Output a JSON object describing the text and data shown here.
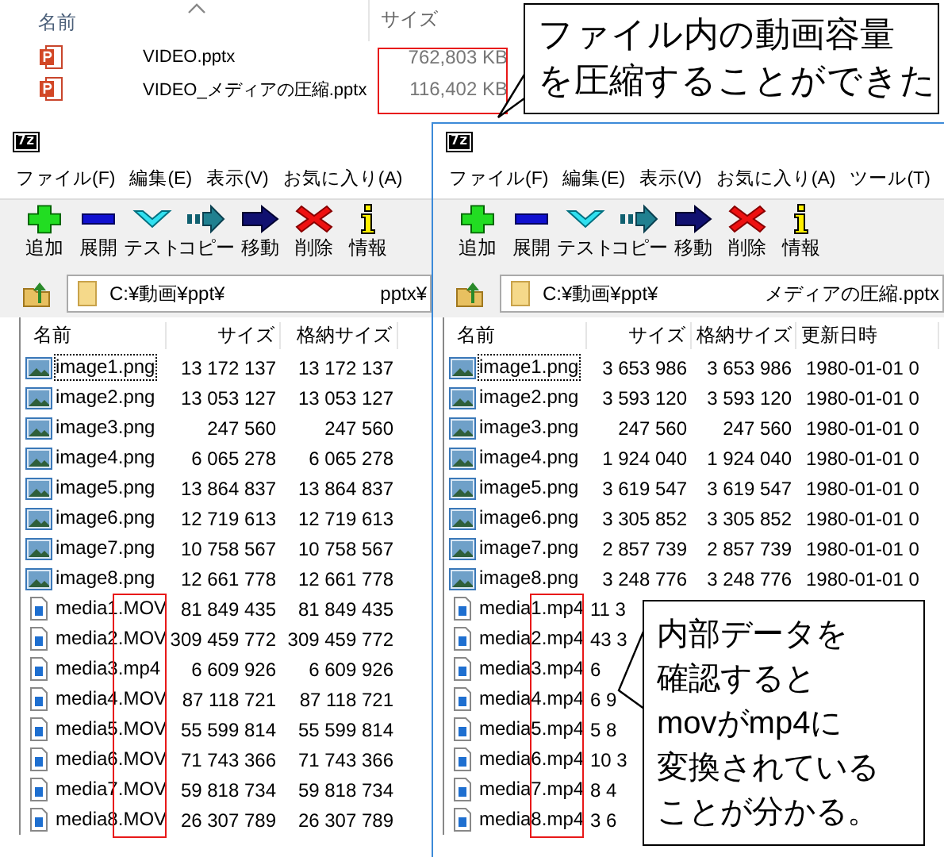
{
  "explorer": {
    "columns": [
      "名前",
      "サイズ"
    ],
    "files": [
      {
        "name": "VIDEO.pptx",
        "size": "762,803 KB"
      },
      {
        "name": "VIDEO_メディアの圧縮.pptx",
        "size": "116,402 KB"
      }
    ]
  },
  "callouts": [
    {
      "lines": [
        "ファイル内の動画容量",
        "を圧縮することができた"
      ]
    },
    {
      "lines": [
        "内部データを",
        "確認すると",
        "movがmp4に",
        "変換されている",
        "ことが分かる。"
      ]
    }
  ],
  "windows": [
    {
      "logo": "7z",
      "menu": [
        "ファイル(F)",
        "編集(E)",
        "表示(V)",
        "お気に入り(A)"
      ],
      "toolbar": [
        {
          "kind": "add",
          "label": "追加"
        },
        {
          "kind": "extract",
          "label": "展開"
        },
        {
          "kind": "test",
          "label": "テスト"
        },
        {
          "kind": "copy",
          "label": "コピー"
        },
        {
          "kind": "move",
          "label": "移動"
        },
        {
          "kind": "delete",
          "label": "削除"
        },
        {
          "kind": "info",
          "label": "情報"
        }
      ],
      "path": "C:¥動画¥ppt¥",
      "path_tail": "pptx¥",
      "columns": [
        "名前",
        "サイズ",
        "格納サイズ"
      ],
      "rows": [
        {
          "kind": "image",
          "name": "image1.png",
          "focused": true,
          "size": "13 172 137",
          "packed": "13 172 137"
        },
        {
          "kind": "image",
          "name": "image2.png",
          "focused": false,
          "size": "13 053 127",
          "packed": "13 053 127"
        },
        {
          "kind": "image",
          "name": "image3.png",
          "focused": false,
          "size": "247 560",
          "packed": "247 560"
        },
        {
          "kind": "image",
          "name": "image4.png",
          "focused": false,
          "size": "6 065 278",
          "packed": "6 065 278"
        },
        {
          "kind": "image",
          "name": "image5.png",
          "focused": false,
          "size": "13 864 837",
          "packed": "13 864 837"
        },
        {
          "kind": "image",
          "name": "image6.png",
          "focused": false,
          "size": "12 719 613",
          "packed": "12 719 613"
        },
        {
          "kind": "image",
          "name": "image7.png",
          "focused": false,
          "size": "10 758 567",
          "packed": "10 758 567"
        },
        {
          "kind": "image",
          "name": "image8.png",
          "focused": false,
          "size": "12 661 778",
          "packed": "12 661 778"
        },
        {
          "kind": "video",
          "name": "media1.MOV",
          "focused": false,
          "size": "81 849 435",
          "packed": "81 849 435"
        },
        {
          "kind": "video",
          "name": "media2.MOV",
          "focused": false,
          "size": "309 459 772",
          "packed": "309 459 772"
        },
        {
          "kind": "video",
          "name": "media3.mp4",
          "focused": false,
          "size": "6 609 926",
          "packed": "6 609 926"
        },
        {
          "kind": "video",
          "name": "media4.MOV",
          "focused": false,
          "size": "87 118 721",
          "packed": "87 118 721"
        },
        {
          "kind": "video",
          "name": "media5.MOV",
          "focused": false,
          "size": "55 599 814",
          "packed": "55 599 814"
        },
        {
          "kind": "video",
          "name": "media6.MOV",
          "focused": false,
          "size": "71 743 366",
          "packed": "71 743 366"
        },
        {
          "kind": "video",
          "name": "media7.MOV",
          "focused": false,
          "size": "59 818 734",
          "packed": "59 818 734"
        },
        {
          "kind": "video",
          "name": "media8.MOV",
          "focused": false,
          "size": "26 307 789",
          "packed": "26 307 789"
        }
      ]
    },
    {
      "logo": "7z",
      "menu": [
        "ファイル(F)",
        "編集(E)",
        "表示(V)",
        "お気に入り(A)",
        "ツール(T)"
      ],
      "toolbar": [
        {
          "kind": "add",
          "label": "追加"
        },
        {
          "kind": "extract",
          "label": "展開"
        },
        {
          "kind": "test",
          "label": "テスト"
        },
        {
          "kind": "copy",
          "label": "コピー"
        },
        {
          "kind": "move",
          "label": "移動"
        },
        {
          "kind": "delete",
          "label": "削除"
        },
        {
          "kind": "info",
          "label": "情報"
        }
      ],
      "path": "C:¥動画¥ppt¥",
      "path_tail": "メディアの圧縮.pptx",
      "columns": [
        "名前",
        "サイズ",
        "格納サイズ",
        "更新日時"
      ],
      "rows": [
        {
          "kind": "image",
          "name": "image1.png",
          "focused": true,
          "size": "3 653 986",
          "packed": "3 653 986",
          "date": "1980-01-01 0"
        },
        {
          "kind": "image",
          "name": "image2.png",
          "focused": false,
          "size": "3 593 120",
          "packed": "3 593 120",
          "date": "1980-01-01 0"
        },
        {
          "kind": "image",
          "name": "image3.png",
          "focused": false,
          "size": "247 560",
          "packed": "247 560",
          "date": "1980-01-01 0"
        },
        {
          "kind": "image",
          "name": "image4.png",
          "focused": false,
          "size": "1 924 040",
          "packed": "1 924 040",
          "date": "1980-01-01 0"
        },
        {
          "kind": "image",
          "name": "image5.png",
          "focused": false,
          "size": "3 619 547",
          "packed": "3 619 547",
          "date": "1980-01-01 0"
        },
        {
          "kind": "image",
          "name": "image6.png",
          "focused": false,
          "size": "3 305 852",
          "packed": "3 305 852",
          "date": "1980-01-01 0"
        },
        {
          "kind": "image",
          "name": "image7.png",
          "focused": false,
          "size": "2 857 739",
          "packed": "2 857 739",
          "date": "1980-01-01 0"
        },
        {
          "kind": "image",
          "name": "image8.png",
          "focused": false,
          "size": "3 248 776",
          "packed": "3 248 776",
          "date": "1980-01-01 0"
        },
        {
          "kind": "video",
          "name": "media1.mp4",
          "focused": false,
          "size": "11 3"
        },
        {
          "kind": "video",
          "name": "media2.mp4",
          "focused": false,
          "size": "43 3"
        },
        {
          "kind": "video",
          "name": "media3.mp4",
          "focused": false,
          "size": "6"
        },
        {
          "kind": "video",
          "name": "media4.mp4",
          "focused": false,
          "size": "6 9"
        },
        {
          "kind": "video",
          "name": "media5.mp4",
          "focused": false,
          "size": "5 8"
        },
        {
          "kind": "video",
          "name": "media6.mp4",
          "focused": false,
          "size": "10 3"
        },
        {
          "kind": "video",
          "name": "media7.mp4",
          "focused": false,
          "size": "8 4"
        },
        {
          "kind": "video",
          "name": "media8.mp4",
          "focused": false,
          "size": "3 6"
        }
      ]
    }
  ]
}
